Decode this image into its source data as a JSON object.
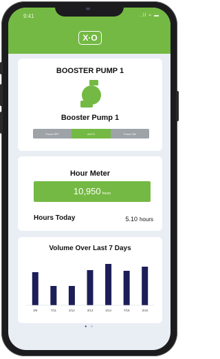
{
  "status_bar": {
    "time": "9:41",
    "icons": "..ll ≈ ▬"
  },
  "header": {
    "logo": "X·O"
  },
  "pump_card": {
    "title": "BOOSTER PUMP 1",
    "name": "Booster Pump 1",
    "icon": "pump-icon",
    "modes": [
      {
        "label": "Force OFF",
        "active": false
      },
      {
        "label": "AUTO",
        "active": true
      },
      {
        "label": "Force ON",
        "active": false
      }
    ]
  },
  "hour_meter": {
    "title": "Hour Meter",
    "value": "10,950",
    "unit": "hours",
    "today_label": "Hours Today",
    "today_value": "5.10",
    "today_unit": "hours"
  },
  "chart_data": {
    "type": "bar",
    "title": "Volume Over Last 7 Days",
    "categories": [
      "3/6",
      "7/11",
      "3/12",
      "3/13",
      "3/14",
      "7/15",
      "3/16"
    ],
    "values": [
      48,
      28,
      28,
      51,
      60,
      50,
      56
    ],
    "ylim": [
      0,
      70
    ],
    "xlabel": "",
    "ylabel": "",
    "grid": false,
    "colors": {
      "bar": "#1c1e58"
    }
  },
  "pagination": {
    "dots": "● ○"
  },
  "colors": {
    "accent": "#74b943",
    "phone": "#1c1c1e",
    "background": "#e9edf4",
    "bar": "#1c1e58",
    "segment_off": "#9ea3a8"
  }
}
